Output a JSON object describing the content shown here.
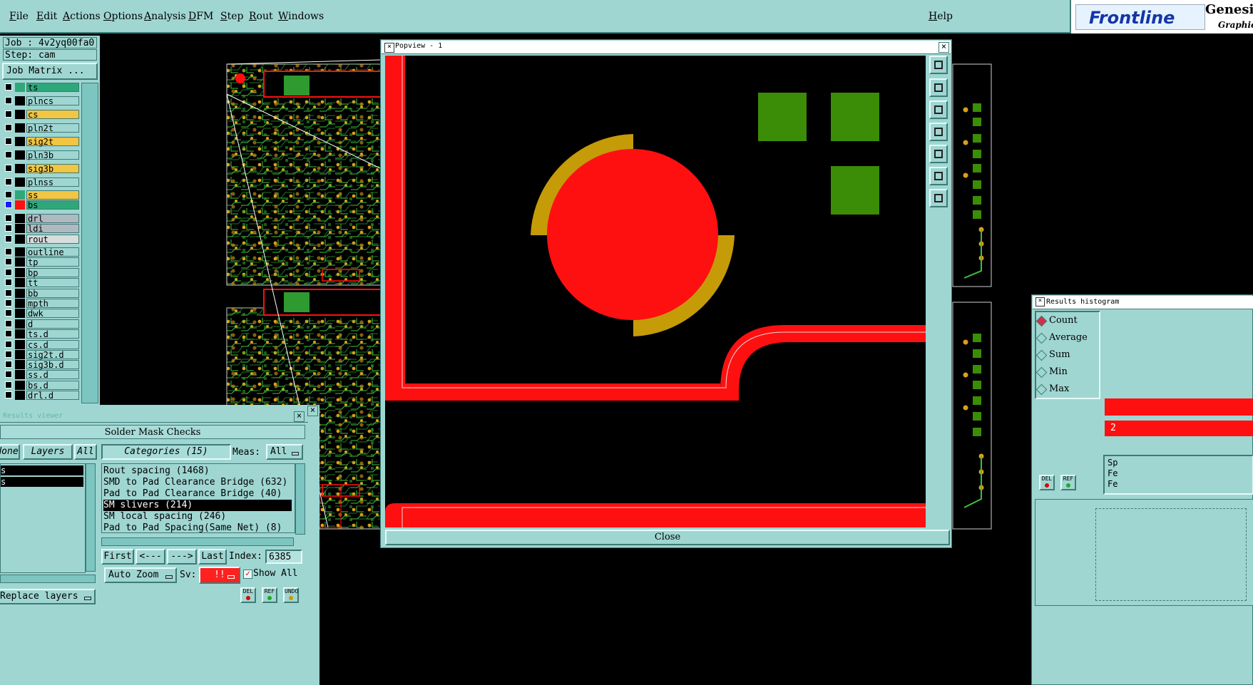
{
  "menubar": {
    "items": [
      "File",
      "Edit",
      "Actions",
      "Options",
      "Analysis",
      "DFM",
      "Step",
      "Rout",
      "Windows"
    ],
    "help": "Help"
  },
  "brand": {
    "logo_text": "Frontline",
    "title": "Genesis",
    "subtitle": "Graphic E"
  },
  "job": {
    "job_label": "Job : 4v2yq00fa0",
    "step_label": "Step: cam",
    "matrix_button": "Job Matrix ..."
  },
  "layers": [
    {
      "name": "ts",
      "bg": "#2ea87a",
      "swatch": "#2ea87a"
    },
    {
      "name": "plncs",
      "bg": "#9fd6d2",
      "swatch": "#000000"
    },
    {
      "name": "cs",
      "bg": "#f2c542",
      "swatch": "#000000"
    },
    {
      "name": "pln2t",
      "bg": "#9fd6d2",
      "swatch": "#000000"
    },
    {
      "name": "sig2t",
      "bg": "#f2c542",
      "swatch": "#000000"
    },
    {
      "name": "pln3b",
      "bg": "#9fd6d2",
      "swatch": "#000000"
    },
    {
      "name": "sig3b",
      "bg": "#f2c542",
      "swatch": "#000000"
    },
    {
      "name": "plnss",
      "bg": "#9fd6d2",
      "swatch": "#000000"
    },
    {
      "name": "ss",
      "bg": "#f2c542",
      "swatch": "#2ea87a"
    },
    {
      "name": "bs",
      "bg": "#2ea87a",
      "swatch": "#ff1010"
    },
    {
      "name": "drl",
      "bg": "#b0b8c0",
      "swatch": "#000000"
    },
    {
      "name": "ldi",
      "bg": "#b0b8c0",
      "swatch": "#000000"
    },
    {
      "name": "rout",
      "bg": "#d8dcdc",
      "swatch": "#000000"
    },
    {
      "name": "outline",
      "bg": "#9fd6d2",
      "swatch": "#000000"
    },
    {
      "name": "tp",
      "bg": "#9fd6d2",
      "swatch": "#000000"
    },
    {
      "name": "bp",
      "bg": "#9fd6d2",
      "swatch": "#000000"
    },
    {
      "name": "tt",
      "bg": "#9fd6d2",
      "swatch": "#000000"
    },
    {
      "name": "bb",
      "bg": "#9fd6d2",
      "swatch": "#000000"
    },
    {
      "name": "mpth",
      "bg": "#9fd6d2",
      "swatch": "#000000"
    },
    {
      "name": "dwk",
      "bg": "#9fd6d2",
      "swatch": "#000000"
    },
    {
      "name": "d",
      "bg": "#9fd6d2",
      "swatch": "#000000"
    },
    {
      "name": "ts.d",
      "bg": "#9fd6d2",
      "swatch": "#000000"
    },
    {
      "name": "cs.d",
      "bg": "#9fd6d2",
      "swatch": "#000000"
    },
    {
      "name": "sig2t.d",
      "bg": "#9fd6d2",
      "swatch": "#000000"
    },
    {
      "name": "sig3b.d",
      "bg": "#9fd6d2",
      "swatch": "#000000"
    },
    {
      "name": "ss.d",
      "bg": "#9fd6d2",
      "swatch": "#000000"
    },
    {
      "name": "bs.d",
      "bg": "#9fd6d2",
      "swatch": "#000000"
    },
    {
      "name": "drl.d",
      "bg": "#9fd6d2",
      "swatch": "#000000"
    }
  ],
  "results_viewer": {
    "title": "Results viewer",
    "heading": "Solder Mask Checks",
    "none_btn": "None",
    "layers_btn": "Layers",
    "all_btn": "All",
    "categories_btn": "Categories (15)",
    "meas_label": "Meas:",
    "meas_value": "All",
    "left_items": [
      "s",
      "s"
    ],
    "categories": [
      "Rout spacing (1468)",
      "SMD to Pad Clearance Bridge (632)",
      "Pad to Pad Clearance Bridge (40)",
      "SM slivers (214)",
      "SM local spacing (246)",
      "Pad to Pad Spacing(Same Net) (8)"
    ],
    "selected_index": 3,
    "first_btn": "First",
    "prev_btn": "<---",
    "next_btn": "--->",
    "last_btn": "Last",
    "index_label": "Index:",
    "index_value": "6385",
    "zoom_value": "Auto Zoom",
    "sv_label": "Sv:",
    "sv_value": "!!",
    "show_all": "Show All",
    "replace_layers": "Replace layers",
    "del_label": "DEL",
    "ref_label": "REF",
    "undo_label": "UNDO"
  },
  "popview": {
    "title": "Popview - 1",
    "close_btn": "Close"
  },
  "histogram": {
    "title": "Results histogram",
    "options": [
      "Count",
      "Average",
      "Sum",
      "Min",
      "Max"
    ],
    "selected": "Count",
    "del_label": "DEL",
    "ref_label": "REF",
    "partial_count": "2",
    "partial_labels": [
      "Sp",
      "Fe",
      "Fe"
    ]
  },
  "colors": {
    "panel": "#9fd6d2",
    "copper": "#ff1010",
    "ring": "#c59b08",
    "pad_green": "#3b8c06",
    "trace": "#3fbf3f"
  }
}
